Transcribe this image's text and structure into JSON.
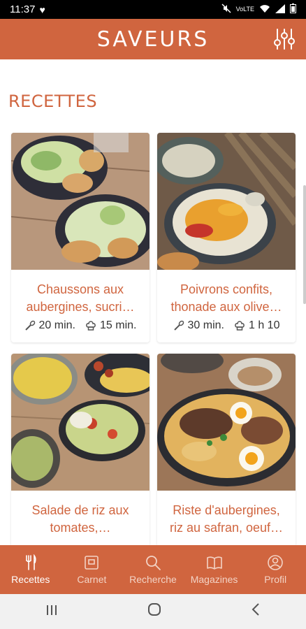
{
  "status": {
    "time": "11:37"
  },
  "app": {
    "title": "SAVEURS"
  },
  "section": {
    "title": "RECETTES"
  },
  "recipes": [
    {
      "title_line1": "Chaussons aux",
      "title_line2": "aubergines, sucri…",
      "prep": "20 min.",
      "cook": "15 min."
    },
    {
      "title_line1": "Poivrons confits,",
      "title_line2": "thonade aux olive…",
      "prep": "30 min.",
      "cook": "1 h 10"
    },
    {
      "title_line1": "Salade de riz aux",
      "title_line2": "tomates,…",
      "prep": "",
      "cook": ""
    },
    {
      "title_line1": "Riste d'aubergines,",
      "title_line2": "riz au safran, oeuf…",
      "prep": "",
      "cook": ""
    }
  ],
  "nav": [
    {
      "label": "Recettes",
      "icon": "cutlery-icon",
      "active": true
    },
    {
      "label": "Carnet",
      "icon": "notebook-icon",
      "active": false
    },
    {
      "label": "Recherche",
      "icon": "search-icon",
      "active": false
    },
    {
      "label": "Magazines",
      "icon": "book-icon",
      "active": false
    },
    {
      "label": "Profil",
      "icon": "profile-icon",
      "active": false
    }
  ],
  "colors": {
    "accent": "#d0653f"
  }
}
